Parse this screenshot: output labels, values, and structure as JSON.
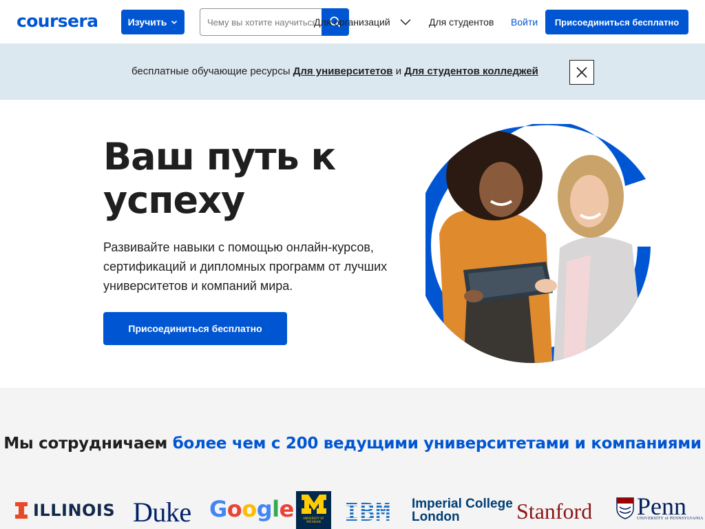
{
  "header": {
    "logo": "coursera",
    "explore_label": "Изучить",
    "search_placeholder": "Чему вы хотите научиться?",
    "orgs_label": "Для организаций",
    "students_label": "Для студентов",
    "login_label": "Войти",
    "join_label": "Присоединиться бесплатно"
  },
  "banner": {
    "prefix": "бесплатные обучающие ресурсы",
    "link_universities": "Для университетов",
    "conjunction": "и",
    "link_colleges": "Для студентов колледжей"
  },
  "hero": {
    "title": "Ваш путь к успеху",
    "subtitle": "Развивайте навыки с помощью онлайн-курсов, сертификаций и дипломных программ от лучших университетов и компаний мира.",
    "cta": "Присоединиться бесплатно"
  },
  "partners": {
    "title_plain": "Мы сотрудничаем",
    "title_highlight": "более чем с 200 ведущими университетами и компаниями",
    "logos": {
      "illinois": "ILLINOIS",
      "duke": "Duke",
      "google": "Google",
      "michigan_sub": "UNIVERSITY OF MICHIGAN",
      "ibm": "IBM",
      "imperial_line1": "Imperial College",
      "imperial_line2": "London",
      "stanford": "Stanford",
      "penn": "Penn",
      "penn_sub": "UNIVERSITY of PENNSYLVANIA"
    }
  },
  "colors": {
    "brand_blue": "#0056d2",
    "banner_bg": "#dbe8f0",
    "partners_bg": "#f4f4f5"
  }
}
